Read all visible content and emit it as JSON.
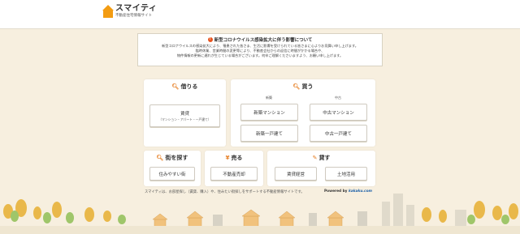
{
  "logo": {
    "title": "スマイティ",
    "subtitle": "不動産住宅情報サイト"
  },
  "notice": {
    "icon": "!",
    "title": "新型コロナウイルス感染拡大に伴う影響について",
    "lines": [
      "新型コロナウイルスの感染拡大により、罹患された皆さま、生活に影響を受けられている皆さまに心よりお見舞い申し上げます。",
      "臨時休業、営業時間の変更等により、不動産会社からの返信に時間がかかる場合や、",
      "物件情報の更新に遅れが生じている場合がございます。何卒ご理解くださいますよう、お願い申し上げます。"
    ]
  },
  "rent": {
    "title": "借りる",
    "icon": "search-icon",
    "button": "賃貸",
    "button_sub": "（マンション・アパート・一戸建て）"
  },
  "buy": {
    "title": "買う",
    "icon": "search-icon",
    "tag_new": "新築",
    "tag_used": "中古",
    "new_mansion": "新築マンション",
    "used_mansion": "中古マンション",
    "new_house": "新築一戸建て",
    "used_house": "中古一戸建て"
  },
  "town": {
    "title": "街を探す",
    "icon": "search-icon",
    "button": "住みやすい街"
  },
  "sell": {
    "title": "売る",
    "icon": "yen-icon",
    "button": "不動産売却"
  },
  "lend": {
    "title": "貸す",
    "icon": "pencil-icon",
    "button1": "賃貸経営",
    "button2": "土地活用"
  },
  "footer": {
    "text": "スマイティは、お部屋探し（賃貸、購入）や、住みたい街探しをサポートする不動産情報サイトです。",
    "powered_label": "Powered by",
    "powered_brand": "kakaku.com"
  },
  "colors": {
    "accent": "#f39c12",
    "background": "#f7efdf",
    "icon": "#e67e22"
  }
}
